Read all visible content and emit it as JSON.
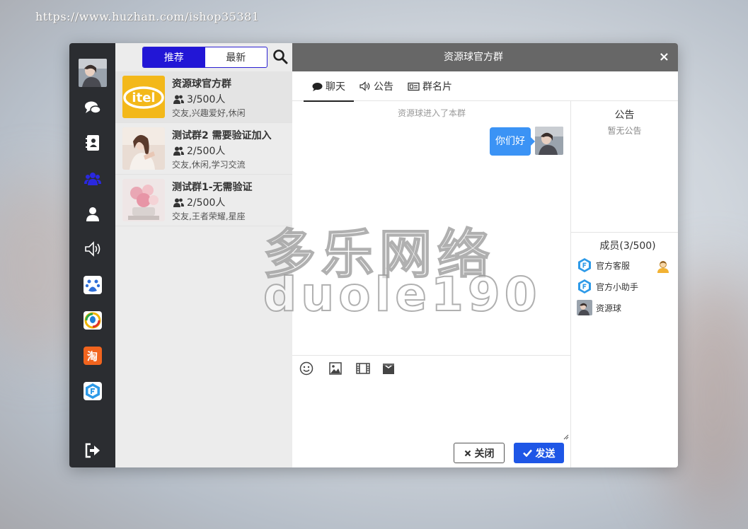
{
  "background_url": "https://www.huzhan.com/ishop35381",
  "nav": {
    "items": [
      "avatar",
      "chat-icon",
      "contacts-icon",
      "group-icon",
      "user-icon",
      "speaker-icon",
      "baidu-app",
      "qq-app",
      "taobao-app",
      "brand-app",
      "logout-icon"
    ],
    "active": "group-icon",
    "taobao_label": "淘"
  },
  "list": {
    "tabs": [
      {
        "label": "推荐",
        "active": true
      },
      {
        "label": "最新",
        "active": false
      }
    ],
    "groups": [
      {
        "name": "资源球官方群",
        "count": "3/500人",
        "tags": "交友,兴趣爱好,休闲",
        "logo_text": "itel"
      },
      {
        "name": "测试群2 需要验证加入",
        "count": "2/500人",
        "tags": "交友,休闲,学习交流"
      },
      {
        "name": "测试群1-无需验证",
        "count": "2/500人",
        "tags": "交友,王者荣耀,星座"
      }
    ]
  },
  "chat": {
    "title": "资源球官方群",
    "close_symbol": "×",
    "tabs": [
      {
        "label": "聊天",
        "active": true
      },
      {
        "label": "公告",
        "active": false
      },
      {
        "label": "群名片",
        "active": false
      }
    ],
    "system_message": "资源球进入了本群",
    "messages": [
      {
        "text": "你们好",
        "self": true
      }
    ],
    "tools": [
      "emoji-icon",
      "image-icon",
      "video-icon",
      "file-icon"
    ],
    "buttons": {
      "close": "关闭",
      "send": "发送"
    }
  },
  "side": {
    "notice_title": "公告",
    "notice_empty": "暂无公告",
    "members_title": "成员(3/500)",
    "members": [
      {
        "name": "官方客服",
        "admin": true
      },
      {
        "name": "官方小助手",
        "admin": false
      },
      {
        "name": "资源球",
        "admin": false
      }
    ]
  },
  "watermark": {
    "line1": "多乐网络",
    "line2": "duole190"
  },
  "colors": {
    "accent": "#2216d6",
    "send": "#1e56e6",
    "bubble": "#3b93f5",
    "header": "#676767",
    "nav_bg": "#2b2d31"
  }
}
